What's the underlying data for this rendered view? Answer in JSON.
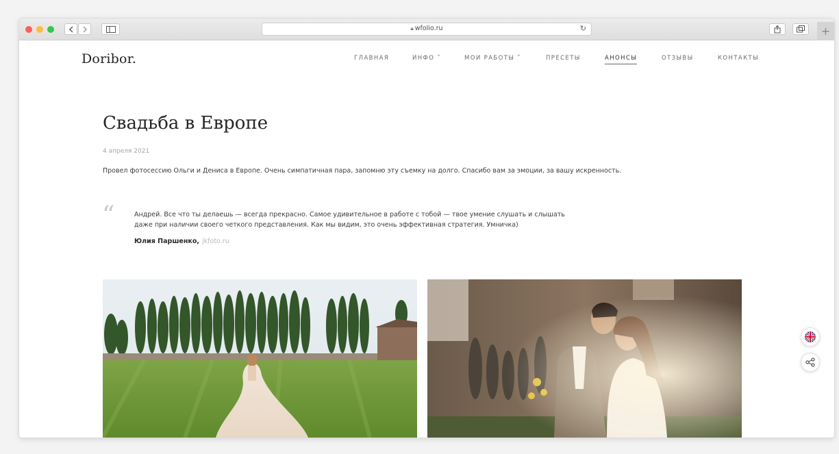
{
  "browser": {
    "url": "wfolio.ru",
    "icons": {
      "back": "chevron-left-icon",
      "forward": "chevron-right-icon",
      "sidebar": "sidebar-icon",
      "lock": "lock-icon",
      "reload": "reload-icon",
      "share": "share-icon",
      "tabs": "tabs-icon",
      "new_tab": "plus-icon"
    }
  },
  "site": {
    "logo": "Doribor.",
    "nav": [
      {
        "label": "ГЛАВНАЯ"
      },
      {
        "label": "ИНФО ˅"
      },
      {
        "label": "МОИ РАБОТЫ ˅"
      },
      {
        "label": "ПРЕСЕТЫ"
      },
      {
        "label": "АНОНСЫ",
        "active": true
      },
      {
        "label": "ОТЗЫВЫ"
      },
      {
        "label": "КОНТАКТЫ"
      }
    ]
  },
  "post": {
    "title": "Свадьба в Европе",
    "date": "4 апреля 2021",
    "description": "Провел фотосессию Ольги и Дениса в Европе. Очень симпатичная пара, запомню эту съемку на долго. Спасибо вам за эмоции, за вашу искренность.",
    "quote": {
      "mark": "“",
      "line1": "Андрей. Все что ты делаешь — всегда прекрасно. Самое удивительное в работе с тобой — твое умение слушать и слышать",
      "line2": "даже при наличии своего четкого представления. Как мы видим, это очень эффективная стратегия. Умничка)",
      "author": "Юлия Паршенко,",
      "author_site": "jkfoto.ru"
    }
  },
  "widgets": {
    "language_icon": "uk-flag-icon",
    "share_icon": "share-nodes-icon"
  },
  "colors": {
    "accent_text": "#222222",
    "muted_text": "#a5a5a5",
    "lawn": "#6f9a3a",
    "sky": "#dfe9ef"
  }
}
